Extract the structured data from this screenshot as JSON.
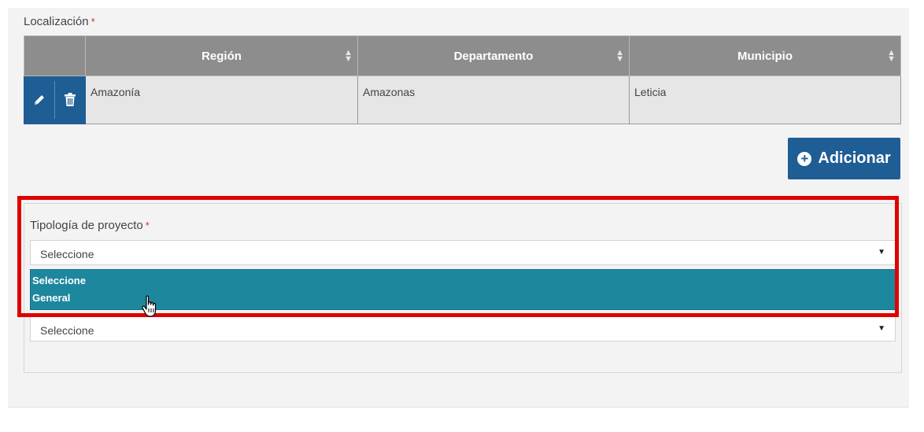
{
  "localizacion": {
    "label": "Localización",
    "required_mark": "*",
    "table": {
      "headers": [
        "Región",
        "Departamento",
        "Municipio"
      ],
      "sort_icon": "sort-icon",
      "rows": [
        {
          "region": "Amazonía",
          "departamento": "Amazonas",
          "municipio": "Leticia"
        }
      ],
      "row_actions": [
        "pencil-icon",
        "trash-icon"
      ]
    },
    "add_button": {
      "label": "Adicionar",
      "icon": "plus-circle-icon"
    }
  },
  "tipologia": {
    "label": "Tipología de proyecto",
    "required_mark": "*",
    "select_value": "Seleccione",
    "options": [
      "Seleccione",
      "General"
    ],
    "second_select_value": "Seleccione"
  },
  "colors": {
    "primary_button": "#1f5d95",
    "dropdown_highlight": "#1d879e",
    "table_header": "#8d8d8d",
    "annotation_border": "#e00000"
  }
}
